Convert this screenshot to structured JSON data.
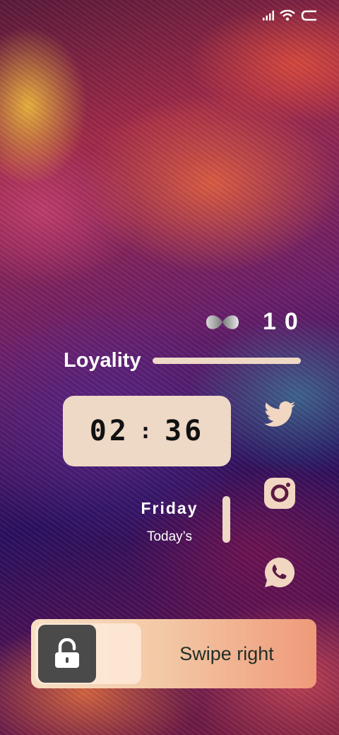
{
  "status_bar": {
    "icons": [
      "signal-icon",
      "wifi-icon",
      "battery-icon"
    ]
  },
  "loyalty": {
    "count": "10",
    "label": "Loyality",
    "icon": "infinity-icon"
  },
  "clock": {
    "hour": "02",
    "separator": ":",
    "minute": "36"
  },
  "date": {
    "day": "Friday",
    "subtitle": "Today’s"
  },
  "social": {
    "icons": [
      "twitter-icon",
      "instagram-icon",
      "whatsapp-icon"
    ]
  },
  "unlock": {
    "label": "Swipe right",
    "icon": "unlock-icon"
  },
  "colors": {
    "accent": "#eed8c6",
    "slider_start": "#f7dfc4",
    "slider_end": "#ef9a7a",
    "lock_bg": "#4a4a4a"
  }
}
